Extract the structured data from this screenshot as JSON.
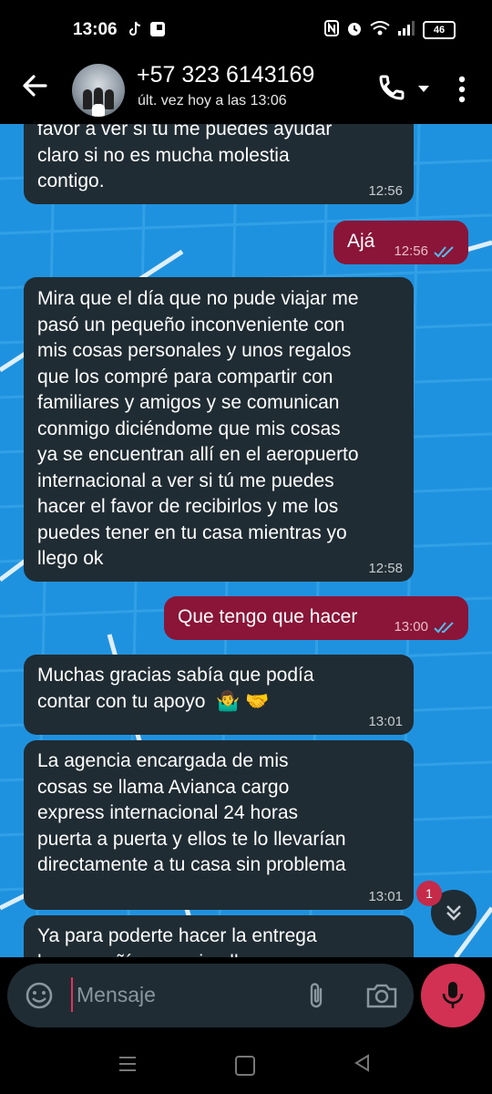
{
  "status_bar": {
    "time": "13:06",
    "battery": "46",
    "icons": [
      "tiktok-icon",
      "app-icon",
      "nfc-icon",
      "alarm-icon",
      "wifi-icon",
      "signal-icon",
      "battery-icon"
    ]
  },
  "header": {
    "contact_name": "+57 323 6143169",
    "last_seen": "últ. vez hoy a las 13:06"
  },
  "messages": [
    {
      "direction": "in",
      "lines": [
        "favor a ver si tú me puedes ayudar",
        "claro si no es mucha molestia",
        "contigo."
      ],
      "time": "12:56"
    },
    {
      "direction": "out",
      "text": "Ajá",
      "time": "12:56",
      "status": "read"
    },
    {
      "direction": "in",
      "lines": [
        "Mira que el día que no pude viajar me",
        "pasó un pequeño inconveniente con",
        "mis cosas personales y unos regalos",
        "que los compré para compartir con",
        "familiares y amigos y se comunican",
        "conmigo diciéndome que mis cosas",
        "ya se encuentran allí en el aeropuerto",
        "internacional a ver si tú me puedes",
        "hacer el favor de recibirlos y me los",
        "puedes tener en tu casa mientras yo",
        "llego ok"
      ],
      "time": "12:58"
    },
    {
      "direction": "out",
      "text": "Que tengo que hacer",
      "time": "13:00",
      "status": "read"
    },
    {
      "direction": "in",
      "lines": [
        "Muchas gracias sabía que podía",
        "contar con tu apoyo"
      ],
      "emojis": [
        "🤷‍♂️",
        "🤝"
      ],
      "time": "13:01"
    },
    {
      "direction": "in",
      "lines": [
        "La agencia encargada de mis",
        "cosas se llama Avianca cargo",
        "express internacional 24 horas",
        "puerta a puerta y ellos te lo llevarían",
        "directamente a tu casa sin problema"
      ],
      "time": "13:01"
    },
    {
      "direction": "in",
      "lines": [
        "Ya para poderte hacer la entrega",
        "la compañía me exige llenar un"
      ]
    }
  ],
  "unread_count": "1",
  "input": {
    "placeholder": "Mensaje"
  },
  "colors": {
    "incoming_bubble": "#202c33",
    "outgoing_bubble": "#8a1538",
    "read_ticks": "#53bdeb",
    "mic_button": "#d23153",
    "wallpaper": "#1f92df"
  }
}
